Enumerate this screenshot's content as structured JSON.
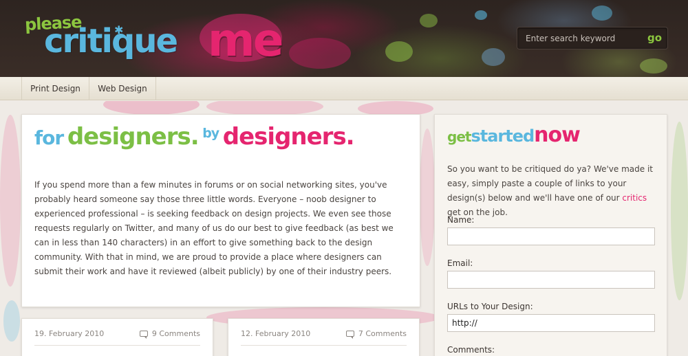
{
  "logo": {
    "please": "please",
    "critique": "critique",
    "me": "me",
    "alt": "please critique me"
  },
  "search": {
    "placeholder": "Enter search keyword",
    "go_label": "go"
  },
  "nav": {
    "items": [
      {
        "label": "Print Design"
      },
      {
        "label": "Web Design"
      }
    ]
  },
  "main": {
    "title": {
      "part1": "for",
      "part2": "designers.",
      "part3": "by",
      "part4": "designers."
    },
    "intro": "If you spend more than a few minutes in forums or on social networking sites, you've probably heard someone say those three little words. Everyone – noob designer to experienced professional – is seeking feedback on design projects. We even see those requests regularly on Twitter, and many of us do our best to give feedback (as best we can in less than 140 characters) in an effort to give something back to the design community. With that in mind, we are proud to provide a place where designers can submit their work and have it reviewed (albeit publicly) by one of their industry peers."
  },
  "posts": [
    {
      "date": "19. February 2010",
      "comments": "9 Comments"
    },
    {
      "date": "12. February 2010",
      "comments": "7 Comments"
    }
  ],
  "sidebar": {
    "title": {
      "part1": "get",
      "part2": "started",
      "part3": "now"
    },
    "intro_before": "So you want to be critiqued do ya? We've made it easy, simply paste a couple of links to your design(s) below and we'll have one of our ",
    "intro_link": "critics",
    "intro_after": " get on the job.",
    "form": {
      "name_label": "Name:",
      "name_value": "",
      "email_label": "Email:",
      "email_value": "",
      "urls_label": "URLs to Your Design:",
      "urls_value": "http://",
      "comments_label": "Comments:"
    }
  },
  "colors": {
    "green": "#7cbf45",
    "blue": "#5ab7de",
    "pink": "#e5256f",
    "header_dark": "#2d2420"
  }
}
